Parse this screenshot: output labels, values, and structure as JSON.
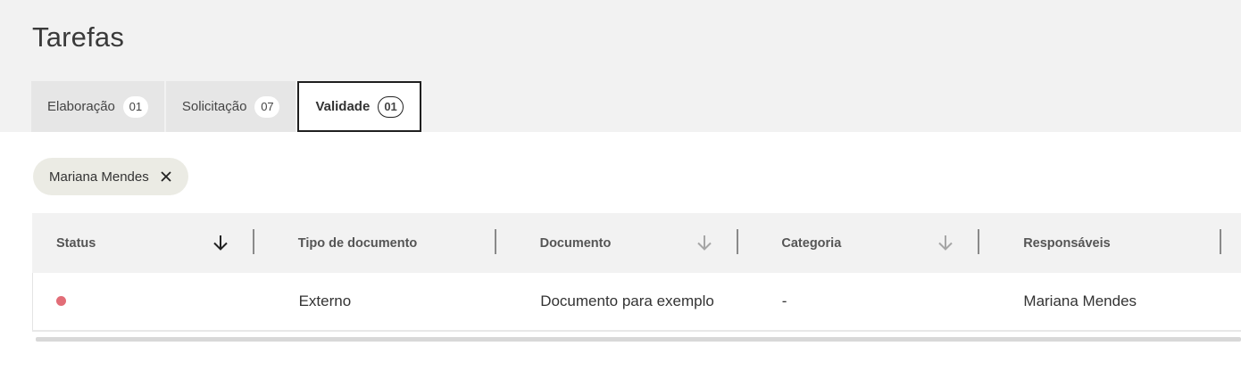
{
  "page": {
    "title": "Tarefas"
  },
  "tabs": [
    {
      "label": "Elaboração",
      "count": "01",
      "active": false
    },
    {
      "label": "Solicitação",
      "count": "07",
      "active": false
    },
    {
      "label": "Validade",
      "count": "01",
      "active": true
    }
  ],
  "filter": {
    "label": "Mariana Mendes",
    "icon": "close-icon"
  },
  "table": {
    "columns": [
      {
        "label": "Status",
        "sortable": true,
        "sort_active": true
      },
      {
        "label": "Tipo de documento",
        "sortable": false,
        "sort_active": false
      },
      {
        "label": "Documento",
        "sortable": true,
        "sort_active": false
      },
      {
        "label": "Categoria",
        "sortable": true,
        "sort_active": false
      },
      {
        "label": "Responsáveis",
        "sortable": false,
        "sort_active": false
      }
    ],
    "rows": [
      {
        "status_color": "#e26d77",
        "tipo": "Externo",
        "documento": "Documento para exemplo",
        "categoria": "-",
        "responsaveis": "Mariana Mendes"
      }
    ]
  },
  "colors": {
    "status_red": "#e26d77",
    "active_sort_arrow": "#222222",
    "inactive_sort_arrow": "#a6a6a6"
  }
}
